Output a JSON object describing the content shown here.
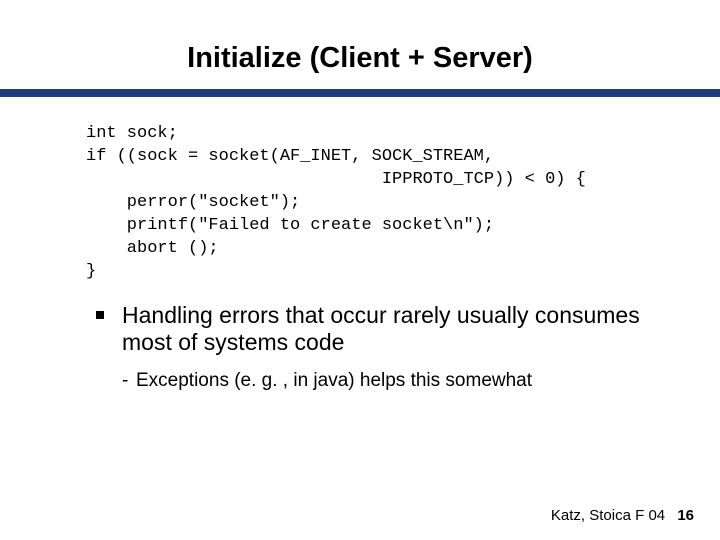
{
  "title": "Initialize (Client + Server)",
  "code": "int sock;\nif ((sock = socket(AF_INET, SOCK_STREAM,\n                             IPPROTO_TCP)) < 0) {\n    perror(\"socket\");\n    printf(\"Failed to create socket\\n\");\n    abort ();\n}",
  "bullet1": "Handling errors that occur rarely usually consumes most of systems code",
  "bullet2": "Exceptions (e. g. , in java) helps this somewhat",
  "footer_text": "Katz, Stoica F 04",
  "page_num": "16"
}
